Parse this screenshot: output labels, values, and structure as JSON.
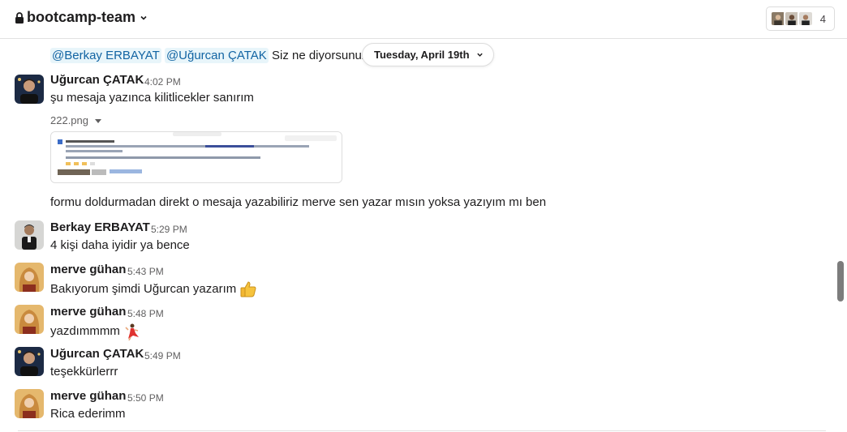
{
  "header": {
    "channel_name": "bootcamp-team",
    "lock_icon": "lock-icon",
    "chevron_icon": "chevron-down-icon",
    "member_count": "4"
  },
  "partial_message": {
    "mention_1": "@Berkay ERBAYAT",
    "mention_2": "@Uğurcan ÇATAK",
    "text": "Siz ne diyorsunuz b"
  },
  "date_divider": {
    "label": "Tuesday, April 19th"
  },
  "messages": [
    {
      "author": "Uğurcan ÇATAK",
      "time": "4:02 PM",
      "lines": [
        "şu mesaja yazınca kilitlicekler sanırım"
      ],
      "attachment": "222.png",
      "followup": "formu doldurmadan direkt o mesaja yazabiliriz merve sen yazar mısın yoksa yazıyım mı ben"
    },
    {
      "author": "Berkay ERBAYAT",
      "time": "5:29 PM",
      "lines": [
        "4 kişi daha iyidir ya bence"
      ]
    },
    {
      "author": "merve gühan",
      "time": "5:43 PM",
      "lines": [
        "Bakıyorum şimdi Uğurcan yazarım"
      ],
      "emoji": "thumbs-up"
    },
    {
      "author": "merve gühan",
      "time": "5:48 PM",
      "lines": [
        "yazdımmmm"
      ],
      "emoji": "dancer"
    },
    {
      "author": "Uğurcan ÇATAK",
      "time": "5:49 PM",
      "lines": [
        "teşekkürlerrr"
      ]
    },
    {
      "author": "merve gühan",
      "time": "5:50 PM",
      "lines": [
        "Rica ederimm"
      ]
    }
  ],
  "colors": {
    "mention_bg": "#e8f5fa",
    "mention_text": "#1264a3",
    "text": "#1d1c1d",
    "muted": "#616061"
  }
}
